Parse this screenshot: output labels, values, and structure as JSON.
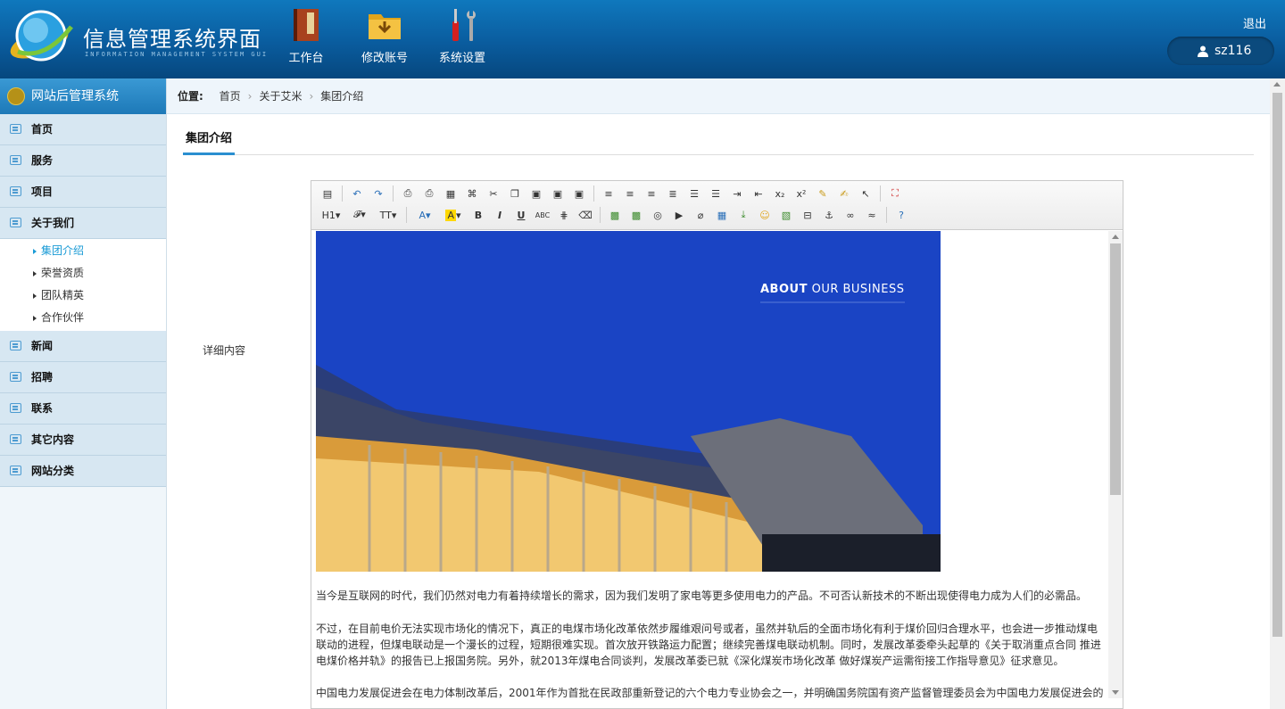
{
  "header": {
    "title": "信息管理系统界面",
    "subtitle": "INFORMATION MANAGEMENT SYSTEM GUI",
    "nav": [
      {
        "label": "工作台",
        "icon": "book-icon"
      },
      {
        "label": "修改账号",
        "icon": "folder-download-icon"
      },
      {
        "label": "系统设置",
        "icon": "tools-icon"
      }
    ],
    "logout": "退出",
    "username": "sz116"
  },
  "sidebar": {
    "title": "网站后管理系统",
    "items": [
      {
        "label": "首页"
      },
      {
        "label": "服务"
      },
      {
        "label": "项目"
      },
      {
        "label": "关于我们"
      }
    ],
    "subitems": [
      "集团介绍",
      "荣誉资质",
      "团队精英",
      "合作伙伴"
    ],
    "items_after": [
      {
        "label": "新闻"
      },
      {
        "label": "招聘"
      },
      {
        "label": "联系"
      },
      {
        "label": "其它内容"
      },
      {
        "label": "网站分类"
      }
    ]
  },
  "breadcrumb": {
    "label": "位置:",
    "items": [
      "首页",
      "关于艾米",
      "集团介绍"
    ]
  },
  "tab": "集团介绍",
  "form": {
    "field_label": "详细内容"
  },
  "editor": {
    "hero_bold": "ABOUT",
    "hero_rest": " OUR BUSINESS",
    "p1": "当今是互联网的时代，我们仍然对电力有着持续增长的需求，因为我们发明了家电等更多使用电力的产品。不可否认新技术的不断出现使得电力成为人们的必需品。",
    "p2": "不过，在目前电价无法实现市场化的情况下，真正的电煤市场化改革依然步履维艰问号或者，虽然并轨后的全面市场化有利于煤价回归合理水平，也会进一步推动煤电联动的进程，但煤电联动是一个漫长的过程，短期很难实现。首次放开铁路运力配置；继续完善煤电联动机制。同时，发展改革委牵头起草的《关于取消重点合同 推进电煤价格并轨》的报告已上报国务院。另外，就2013年煤电合同谈判，发展改革委已就《深化煤炭市场化改革 做好煤炭产运需衔接工作指导意见》征求意见。",
    "p3": "中国电力发展促进会在电力体制改革后，2001年作为首批在民政部重新登记的六个电力专业协会之一，并明确国务院国有资产监督管理委员会为中国电力发展促进会的"
  },
  "colors": {
    "accent": "#2a8fd0",
    "header": "#0a5c9e"
  }
}
